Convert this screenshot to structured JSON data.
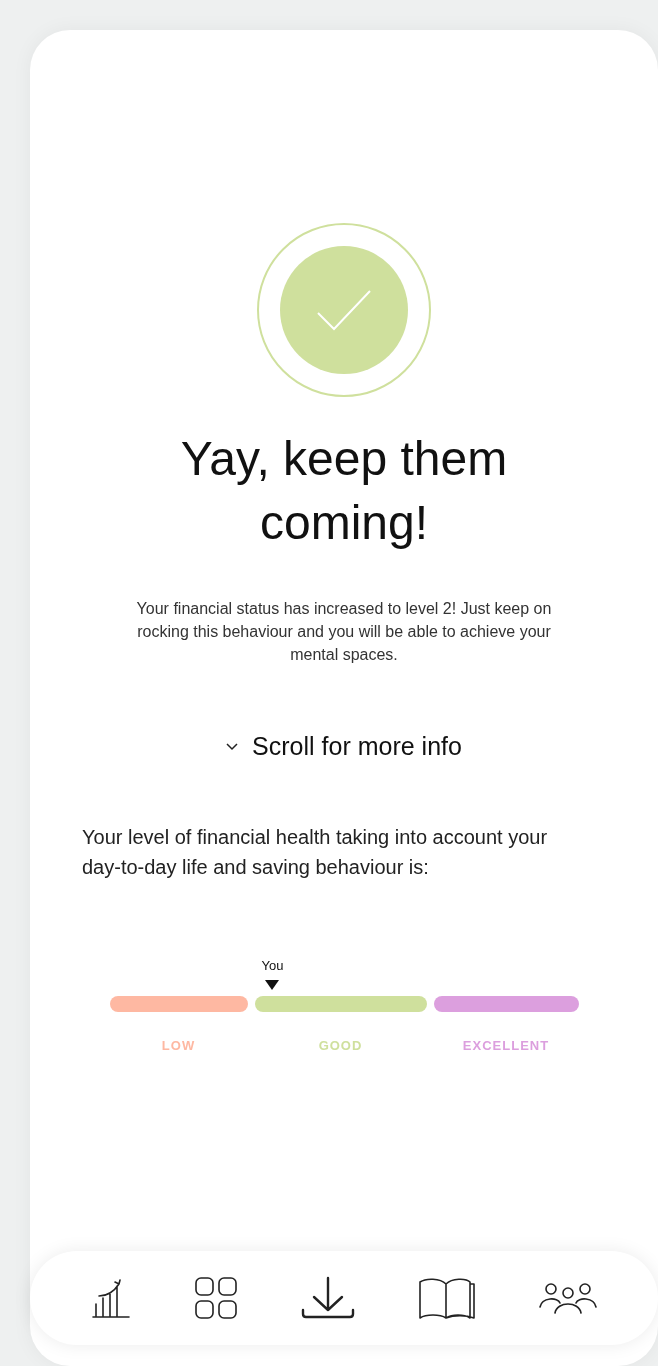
{
  "result": {
    "title": "Yay, keep them coming!",
    "message": "Your financial status has increased to level 2! Just keep on rocking this behaviour and you will be able to achieve your mental spaces.",
    "scroll_hint": "Scroll for more info"
  },
  "health": {
    "description": "Your level of financial health taking into account your day-to-day life and saving behaviour is:",
    "marker_label": "You",
    "segments": [
      {
        "label": "LOW",
        "color": "#feb8a2",
        "selected": false
      },
      {
        "label": "GOOD",
        "color": "#cfe09d",
        "selected": true
      },
      {
        "label": "EXCELLENT",
        "color": "#dc9fde",
        "selected": false
      }
    ]
  },
  "nav": [
    {
      "kind": "chart"
    },
    {
      "kind": "grid"
    },
    {
      "kind": "download"
    },
    {
      "kind": "book"
    },
    {
      "kind": "people"
    }
  ]
}
